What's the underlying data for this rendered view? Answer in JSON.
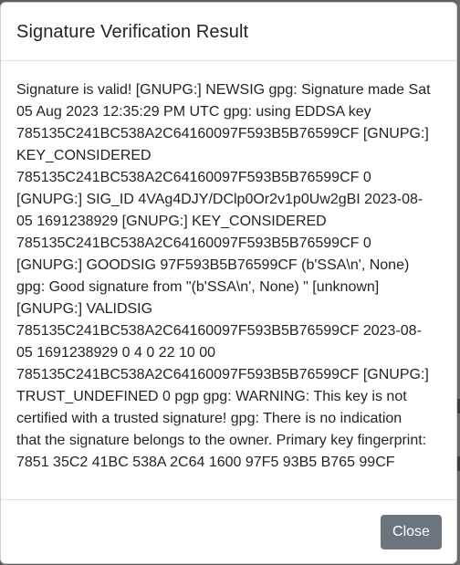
{
  "dialog": {
    "title": "Signature Verification Result",
    "body_lines": [
      "Signature is valid! [GNUPG:] NEWSIG gpg: Signature made Sat",
      "05 Aug 2023 12:35:29 PM UTC gpg: using EDDSA key",
      "785135C241BC538A2C64160097F593B5B76599CF [GNUPG:]",
      "KEY_CONSIDERED",
      "785135C241BC538A2C64160097F593B5B76599CF 0",
      "[GNUPG:] SIG_ID 4VAg4DJY/DClp0Or2v1p0Uw2gBI 2023-08-",
      "05 1691238929 [GNUPG:] KEY_CONSIDERED",
      "785135C241BC538A2C64160097F593B5B76599CF 0",
      "[GNUPG:] GOODSIG 97F593B5B76599CF (b'SSA\\n', None)",
      "gpg: Good signature from \"(b'SSA\\n', None) \" [unknown]",
      "[GNUPG:] VALIDSIG",
      "785135C241BC538A2C64160097F593B5B76599CF 2023-08-",
      "05 1691238929 0 4 0 22 10 00",
      "785135C241BC538A2C64160097F593B5B76599CF [GNUPG:]",
      "TRUST_UNDEFINED 0 pgp gpg: WARNING: This key is not",
      "certified with a trusted signature! gpg: There is no indication",
      "that the signature belongs to the owner. Primary key fingerprint:",
      "7851 35C2 41BC 538A 2C64 1600 97F5 93B5 B765 99CF"
    ],
    "close_label": "Close"
  },
  "colors": {
    "backdrop": "#5d5d5d",
    "close_button": "#6c757d",
    "text": "#212529"
  }
}
